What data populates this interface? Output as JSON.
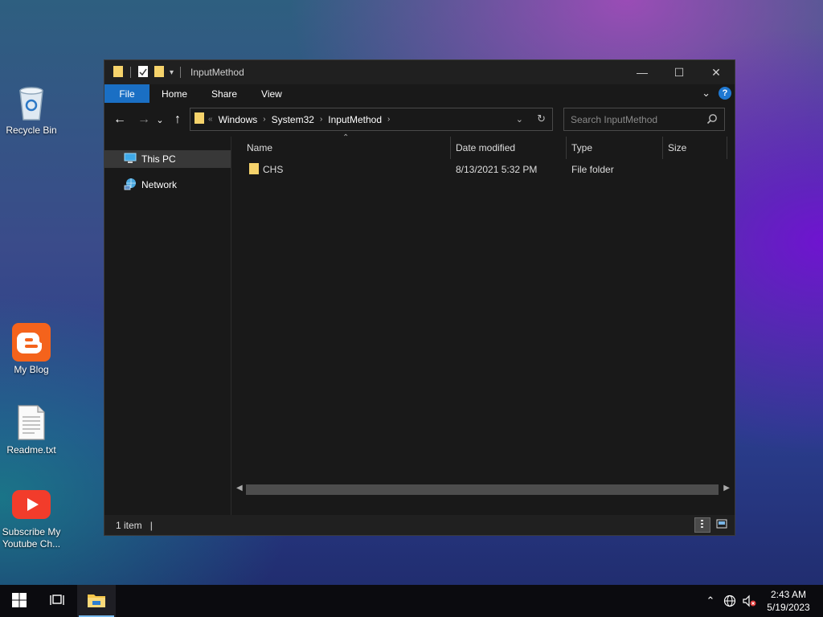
{
  "desktop": {
    "icons": [
      {
        "label": "Recycle Bin",
        "icon": "recycle-bin-icon"
      },
      {
        "label": "My Blog",
        "icon": "blogger-icon"
      },
      {
        "label": "Readme.txt",
        "icon": "text-file-icon"
      },
      {
        "label": "Subscribe My Youtube Ch...",
        "icon": "youtube-icon"
      }
    ]
  },
  "window": {
    "title": "InputMethod",
    "controls": {
      "minimize": "—",
      "maximize": "☐",
      "close": "✕"
    }
  },
  "ribbon": {
    "tabs": [
      "File",
      "Home",
      "Share",
      "View"
    ],
    "help": "?",
    "collapse": "⌄"
  },
  "navigation": {
    "back": "←",
    "forward": "→",
    "recent": "⌄",
    "up": "↑",
    "breadcrumb": [
      "Windows",
      "System32",
      "InputMethod"
    ],
    "overflow": "«",
    "refresh": "↻"
  },
  "search": {
    "placeholder": "Search InputMethod"
  },
  "navpane": {
    "items": [
      {
        "label": "This PC",
        "icon": "this-pc-icon",
        "selected": true
      },
      {
        "label": "Network",
        "icon": "network-icon",
        "selected": false
      }
    ]
  },
  "columns": [
    "Name",
    "Date modified",
    "Type",
    "Size"
  ],
  "files": [
    {
      "name": "CHS",
      "date_modified": "8/13/2021 5:32 PM",
      "type": "File folder",
      "size": ""
    }
  ],
  "status": {
    "item_count": "1 item"
  },
  "taskbar": {
    "time": "2:43 AM",
    "date": "5/19/2023"
  },
  "colors": {
    "accent": "#1a6fc4",
    "window_bg": "#191919",
    "folder": "#f6d36b"
  }
}
